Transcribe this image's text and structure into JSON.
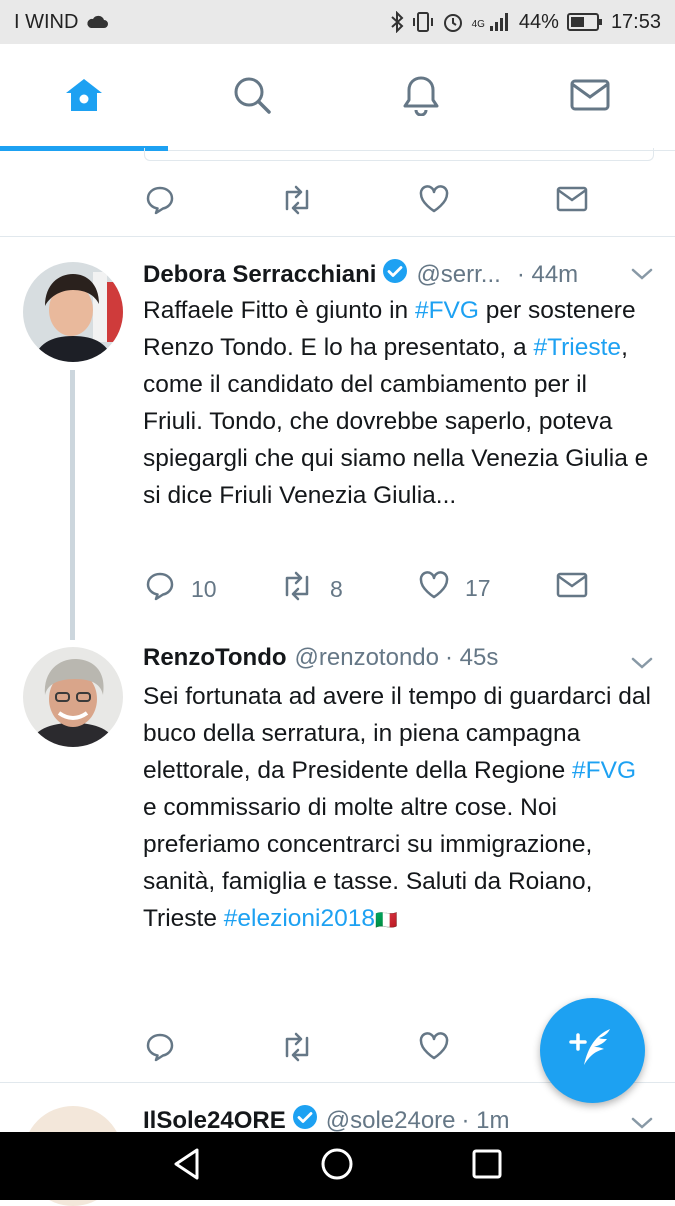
{
  "status_bar": {
    "carrier": "I WIND",
    "network": "4G",
    "battery": "44%",
    "time": "17:53",
    "icons": [
      "cloud-icon",
      "bluetooth-icon",
      "vibrate-icon",
      "alarm-icon",
      "signal-icon",
      "battery-icon"
    ]
  },
  "tabs": [
    {
      "name": "home",
      "icon": "home-icon",
      "active": true
    },
    {
      "name": "search",
      "icon": "search-icon",
      "active": false
    },
    {
      "name": "notifications",
      "icon": "bell-icon",
      "active": false
    },
    {
      "name": "messages",
      "icon": "mail-icon",
      "active": false
    }
  ],
  "tweets": [
    {
      "name": "Debora Serracchiani",
      "handle": "@serr...",
      "time": "· 44m",
      "verified": true,
      "text_parts": [
        "Raffaele Fitto è giunto in ",
        "#FVG",
        " per sostenere Renzo Tondo. E lo ha presentato, a ",
        "#Trieste",
        ", come il candidato del cambiamento per il Friuli. Tondo, che dovrebbe saperlo, poteva spiegargli che qui siamo nella Venezia Giulia e si dice Friuli Venezia Giulia..."
      ],
      "replies": "10",
      "retweets": "8",
      "likes": "17"
    },
    {
      "name": "RenzoTondo",
      "handle": "@renzotondo",
      "time": "· 45s",
      "verified": false,
      "text_parts": [
        "Sei fortunata ad avere il tempo di guardarci dal buco della serratura, in piena campagna elettorale, da Presidente della Regione ",
        "#FVG",
        " e commissario di molte altre cose. Noi preferiamo concentrarci su immigrazione, sanità, famiglia e tasse. Saluti da Roiano, Trieste ",
        "#elezioni2018",
        "🇮🇹"
      ]
    },
    {
      "name": "IlSole24ORE",
      "handle": "@sole24ore",
      "time": "· 1m",
      "verified": true
    }
  ],
  "colors": {
    "accent": "#1da1f2",
    "text": "#14171a",
    "muted": "#657786",
    "divider": "#e1e8ed"
  },
  "nav_buttons": [
    "back-icon",
    "home-circle-icon",
    "recents-icon"
  ],
  "fab_icon": "compose-tweet-icon"
}
